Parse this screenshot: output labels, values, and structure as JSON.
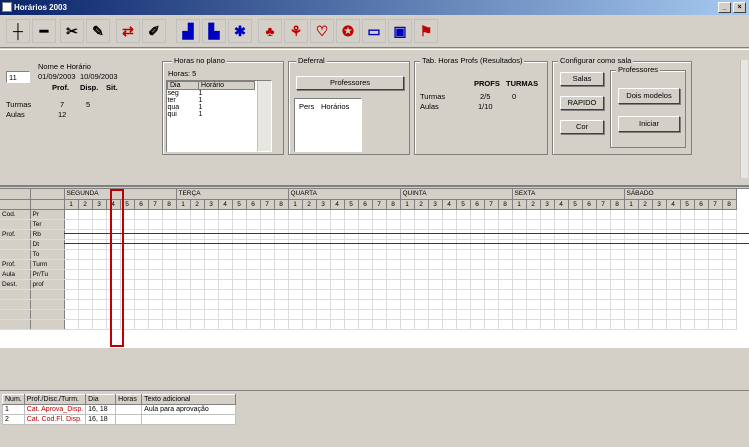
{
  "window": {
    "title": "Horários 2003"
  },
  "toolbar": {
    "icons": [
      "add-row-icon",
      "remove-row-icon",
      "cut-icon",
      "tool-icon",
      "swap-icon",
      "edit-icon",
      "chart-icon",
      "bar-chart-icon",
      "asterisk-icon",
      "group-icon",
      "split-icon",
      "heart-icon",
      "shield-icon",
      "window-icon",
      "computer-icon",
      "flag-icon"
    ]
  },
  "left": {
    "day": "11",
    "name_label": "Nome e Horário",
    "date1": "01/09/2003",
    "date2": "10/09/2003",
    "c1": "Prof.",
    "c2": "Disp.",
    "c3": "Sit.",
    "row1_label": "Turmas",
    "row1_v1": "7",
    "row1_v2": "5",
    "row2_label": "Aulas",
    "row2_v1": "12",
    "row2_v2": ""
  },
  "horas": {
    "legend": "Horas no plano",
    "sub": "Horas: 5",
    "col1": "Dia",
    "col2": "Horário",
    "rows": [
      [
        "seg",
        "1"
      ],
      [
        "ter",
        "1"
      ],
      [
        "qua",
        "1"
      ],
      [
        "qui",
        "1"
      ]
    ]
  },
  "deferral": {
    "legend": "Deferral",
    "btn1": "Professores",
    "sublabel1": "Pers",
    "sublabel2": "Horários"
  },
  "table_info": {
    "legend": "Tab. Horas Profs (Resultados)",
    "h1": "PROFS",
    "h2": "TURMAS",
    "r1_label": "Turmas",
    "r1_v1": "2/5",
    "r1_v2": "0",
    "r2_label": "Aulas",
    "r2_v1": "1/10",
    "r2_v2": ""
  },
  "conf": {
    "legend": "Configurar como sala",
    "b1": "Salas",
    "b2": "RAPIDO",
    "b3": "Cor",
    "legend2": "Professores",
    "b4": "Dois modelos",
    "b5": "Iniciar"
  },
  "grid": {
    "days": [
      "SEGUNDA",
      "TERÇA",
      "QUARTA",
      "QUINTA",
      "SEXTA",
      "SÁBADO"
    ],
    "periods": [
      "1",
      "2",
      "3",
      "4",
      "5",
      "6",
      "7",
      "8"
    ],
    "rows": [
      {
        "h1": "Cod.",
        "h2": "Pr"
      },
      {
        "h1": "",
        "h2": "Ter"
      },
      {
        "h1": "Prof.",
        "h2": "Rb"
      },
      {
        "h1": "",
        "h2": "Dt"
      },
      {
        "h1": "",
        "h2": "To"
      },
      {
        "h1": "Prof.",
        "h2": "Turm"
      },
      {
        "h1": "Aula",
        "h2": "Pr/Tu"
      },
      {
        "h1": "Dest.",
        "h2": "prof"
      }
    ]
  },
  "bottom": {
    "headers": [
      "Num.",
      "Prof./Disc./Turm.",
      "Dia",
      "Horas",
      "Texto adicional"
    ],
    "rows": [
      [
        "1",
        "Cat. Aprova_Disp.",
        "16, 18",
        "",
        "Aula para aprovação"
      ],
      [
        "2",
        "Cat. Cod.Fl. Disp.",
        "16, 18",
        "",
        ""
      ]
    ]
  }
}
